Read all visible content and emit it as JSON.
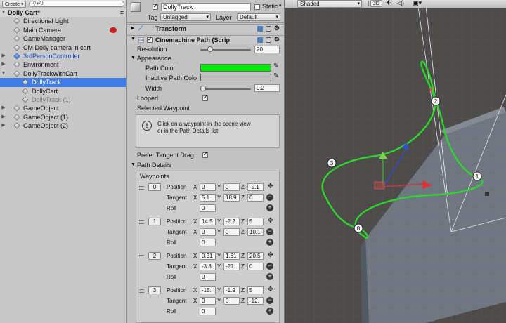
{
  "hierarchy": {
    "create_label": "Create",
    "search_placeholder": "All",
    "scene_name": "Dolly Cart*",
    "items": [
      {
        "label": "Directional Light",
        "depth": 1
      },
      {
        "label": "Main Camera",
        "depth": 1
      },
      {
        "label": "GameManager",
        "depth": 1
      },
      {
        "label": "CM Dolly camera in cart",
        "depth": 1
      },
      {
        "label": "3rdPersonController",
        "depth": 1
      },
      {
        "label": "Environment",
        "depth": 1
      },
      {
        "label": "DollyTrackWithCart",
        "depth": 1
      },
      {
        "label": "DollyTrack",
        "depth": 2
      },
      {
        "label": "DollyCart",
        "depth": 2
      },
      {
        "label": "DollyTrack (1)",
        "depth": 2
      },
      {
        "label": "GameObject",
        "depth": 1
      },
      {
        "label": "GameObject (1)",
        "depth": 1
      },
      {
        "label": "GameObject (2)",
        "depth": 1
      }
    ]
  },
  "inspector": {
    "object_name": "DollyTrack",
    "static_label": "Static",
    "tag_label": "Tag",
    "tag_value": "Untagged",
    "layer_label": "Layer",
    "layer_value": "Default",
    "transform_title": "Transform",
    "path_title": "Cinemachine Path (Scrip",
    "resolution_label": "Resolution",
    "resolution_value": "20",
    "resolution_fraction": 0.2,
    "appearance_label": "Appearance",
    "path_color_label": "Path Color",
    "path_color": "#00ee00",
    "inactive_color_label": "Inactive Path Colo",
    "inactive_color": "#bfbfbf",
    "width_label": "Width",
    "width_value": "0.2",
    "width_fraction": 0.0,
    "looped_label": "Looped",
    "selected_waypoint_label": "Selected Waypoint:",
    "help_text_1": "Click on a waypoint in the scene view",
    "help_text_2": "or in the Path Details list",
    "prefer_tangent_label": "Prefer Tangent Drag",
    "path_details_label": "Path Details",
    "waypoints_label": "Waypoints",
    "position_label": "Position",
    "tangent_label": "Tangent",
    "roll_label": "Roll",
    "waypoints": [
      {
        "index": "0",
        "pos": [
          "0",
          "0",
          "-9.1"
        ],
        "tan": [
          "5.1",
          "18.9",
          "0"
        ],
        "roll": "0"
      },
      {
        "index": "1",
        "pos": [
          "14.5",
          "-2.2",
          "5"
        ],
        "tan": [
          "0",
          "0",
          "10.1"
        ],
        "roll": "0"
      },
      {
        "index": "2",
        "pos": [
          "0.31",
          "1.61",
          "20.5"
        ],
        "tan": [
          "-3.8",
          "-27.",
          "0"
        ],
        "roll": "0"
      },
      {
        "index": "3",
        "pos": [
          "-15.",
          "-1.9",
          "5"
        ],
        "tan": [
          "0",
          "0",
          "-12."
        ],
        "roll": "0"
      }
    ]
  },
  "scene": {
    "shading": "Shaded",
    "mode_2d": "2D",
    "waypoint_labels": [
      "0",
      "1",
      "2",
      "3"
    ],
    "colors": {
      "track": "#2dd52d",
      "ground": "#6f7681",
      "background": "#4e4c4a"
    }
  }
}
